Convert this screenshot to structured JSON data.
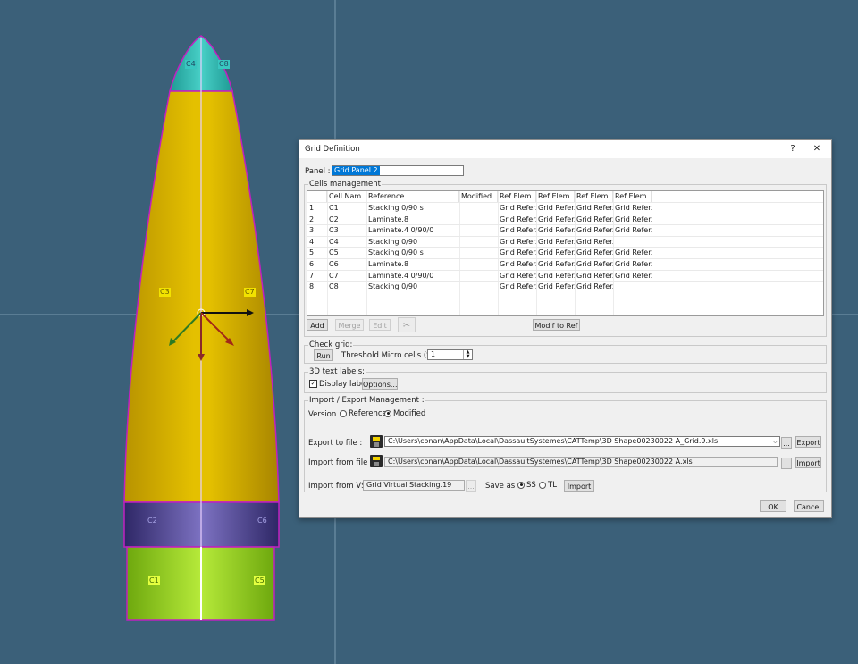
{
  "viewport": {
    "labels": {
      "c1": "C1",
      "c2": "C2",
      "c3": "C3",
      "c4": "C4",
      "c5": "C5",
      "c6": "C6",
      "c7": "C7",
      "c8": "C8"
    },
    "colors": {
      "background": "#3b6079",
      "cone_yellow": "#d9b200",
      "tip_teal": "#2ab5ad",
      "band_purple": "#4a3f8c",
      "base_green": "#8bc21c",
      "outline": "#c020c0"
    }
  },
  "dialog": {
    "title": "Grid Definition",
    "help_button": "?",
    "close_button": "✕",
    "panel_label": "Panel :",
    "panel_value": "Grid Panel.2",
    "cells_management": {
      "legend": "Cells management",
      "columns": [
        "",
        "Cell Nam...",
        "Reference",
        "Modified",
        "Ref Elem",
        "Ref Elem",
        "Ref Elem",
        "Ref Elem"
      ],
      "rows": [
        [
          "1",
          "C1",
          "Stacking 0/90 s",
          "",
          "Grid Refer...",
          "Grid Refer...",
          "Grid Refer...",
          "Grid Refer..."
        ],
        [
          "2",
          "C2",
          "Laminate.8",
          "",
          "Grid Refer...",
          "Grid Refer...",
          "Grid Refer...",
          "Grid Refer..."
        ],
        [
          "3",
          "C3",
          "Laminate.4 0/90/0",
          "",
          "Grid Refer...",
          "Grid Refer...",
          "Grid Refer...",
          "Grid Refer..."
        ],
        [
          "4",
          "C4",
          "Stacking 0/90",
          "",
          "Grid Refer...",
          "Grid Refer...",
          "Grid Refer...",
          ""
        ],
        [
          "5",
          "C5",
          "Stacking 0/90 s",
          "",
          "Grid Refer...",
          "Grid Refer...",
          "Grid Refer...",
          "Grid Refer..."
        ],
        [
          "6",
          "C6",
          "Laminate.8",
          "",
          "Grid Refer...",
          "Grid Refer...",
          "Grid Refer...",
          "Grid Refer..."
        ],
        [
          "7",
          "C7",
          "Laminate.4 0/90/0",
          "",
          "Grid Refer...",
          "Grid Refer...",
          "Grid Refer...",
          "Grid Refer..."
        ],
        [
          "8",
          "C8",
          "Stacking 0/90",
          "",
          "Grid Refer...",
          "Grid Refer...",
          "Grid Refer...",
          ""
        ]
      ],
      "add": "Add",
      "merge": "Merge",
      "edit": "Edit",
      "modif_to_ref": "Modif to Ref"
    },
    "check_grid": {
      "legend": "Check grid:",
      "run": "Run",
      "threshold_label": "Threshold Micro cells (%) :",
      "threshold_value": "1"
    },
    "text_labels": {
      "legend": "3D text labels:",
      "display_label": "Display label",
      "display_checked": true,
      "options": "Options..."
    },
    "import_export": {
      "legend": "Import / Export Management :",
      "version_label": "Version :",
      "version_reference": "Reference",
      "version_modified": "Modified",
      "export_label": "Export to file :",
      "export_path": "C:\\Users\\conan\\AppData\\Local\\DassaultSystemes\\CATTemp\\3D Shape00230022 A_Grid.9.xls",
      "export_button": "Export",
      "browse": "...",
      "import_label": "Import from file :",
      "import_path": "C:\\Users\\conan\\AppData\\Local\\DassaultSystemes\\CATTemp\\3D Shape00230022 A.xls",
      "import_button": "Import",
      "import_vs_label": "Import from VS :",
      "import_vs_value": "Grid Virtual Stacking.19",
      "save_as_label": "Save as :",
      "save_ss": "SS",
      "save_tl": "TL",
      "import_vs_button": "Import"
    },
    "ok": "OK",
    "cancel": "Cancel"
  }
}
